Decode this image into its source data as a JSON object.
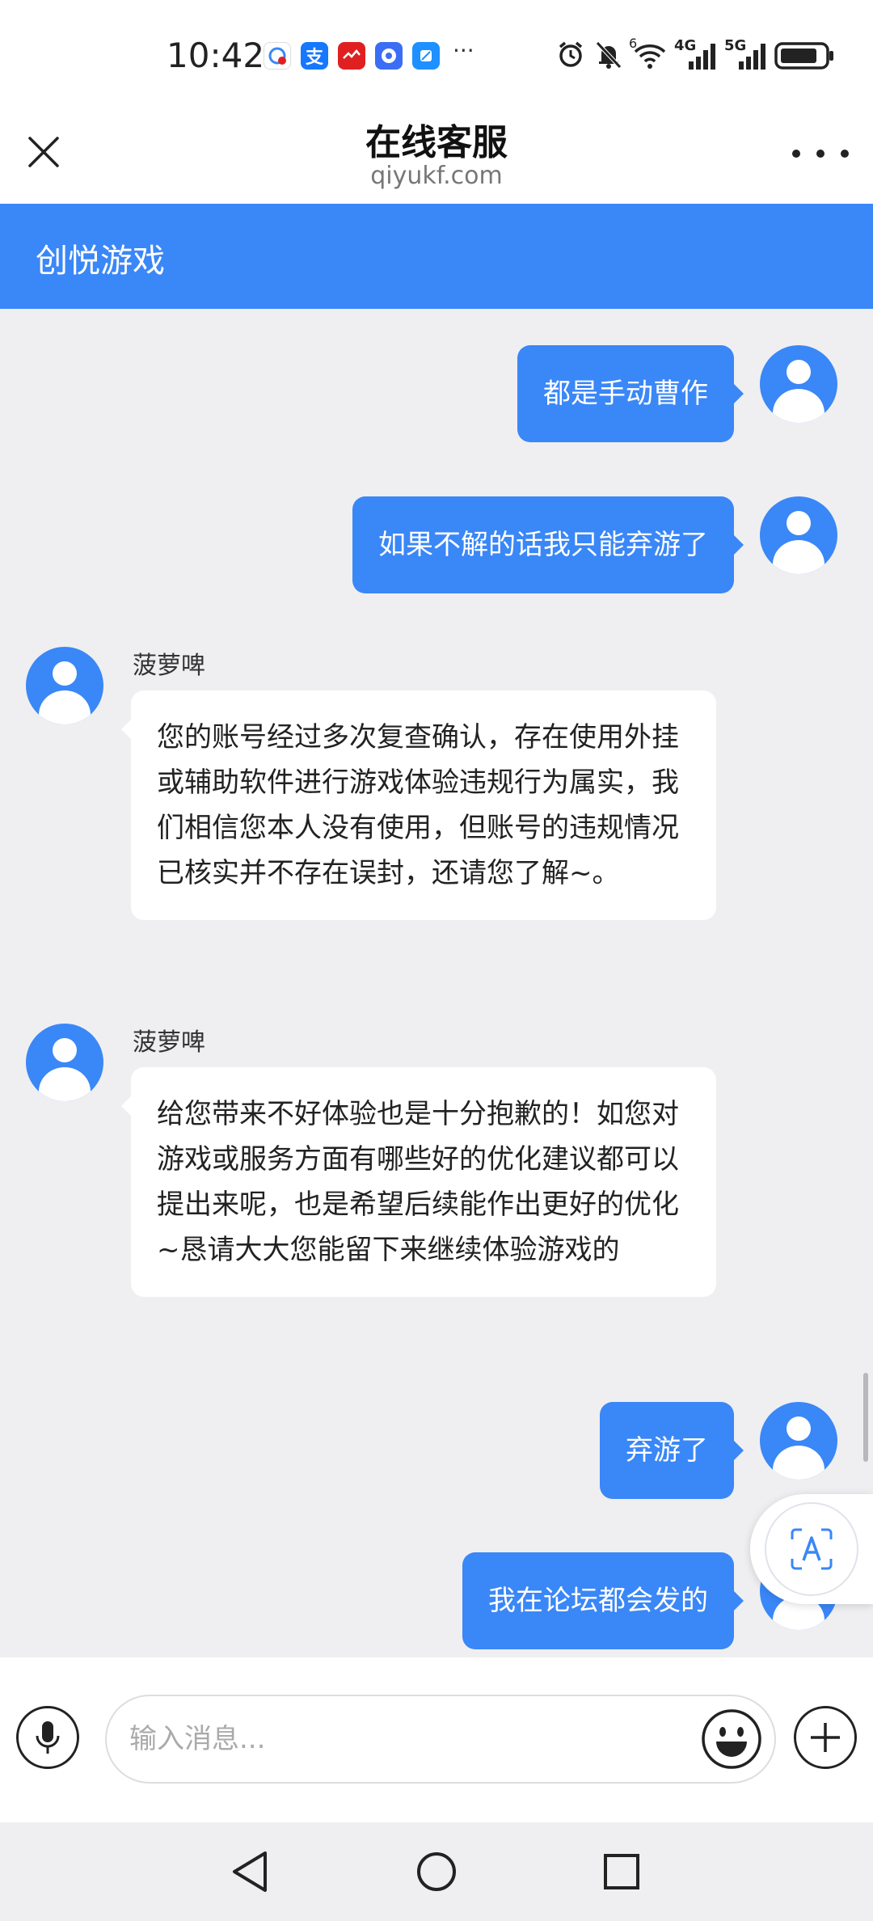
{
  "status_bar": {
    "time": "10:42",
    "notification_icons": [
      {
        "name": "app-notify-icon",
        "color": "#ffffff",
        "glyph": "◉"
      },
      {
        "name": "alipay-icon",
        "color": "#1677ff",
        "glyph": "支"
      },
      {
        "name": "red-app-icon",
        "color": "#e02020",
        "glyph": "✦"
      },
      {
        "name": "music-icon",
        "color": "#3b6ef5",
        "glyph": "♫"
      },
      {
        "name": "blue-app-icon",
        "color": "#1e90ff",
        "glyph": "◆"
      }
    ],
    "overflow": "···",
    "network_6": "6",
    "network_4g": "4G",
    "network_5g": "5G"
  },
  "titlebar": {
    "title": "在线客服",
    "domain": "qiyukf.com"
  },
  "header": {
    "name": "创悦游戏"
  },
  "messages": [
    {
      "direction": "out",
      "text": "都是手动曹作"
    },
    {
      "direction": "out",
      "text": "如果不解的话我只能弃游了"
    },
    {
      "direction": "in",
      "sender": "菠萝啤",
      "text": "您的账号经过多次复查确认，存在使用外挂或辅助软件进行游戏体验违规行为属实，我们相信您本人没有使用，但账号的违规情况已核实并不存在误封，还请您了解~。"
    },
    {
      "direction": "in",
      "sender": "菠萝啤",
      "text": "给您带来不好体验也是十分抱歉的！如您对游戏或服务方面有哪些好的优化建议都可以提出来呢，也是希望后续能作出更好的优化~恳请大大您能留下来继续体验游戏的"
    },
    {
      "direction": "out",
      "text": "弃游了"
    },
    {
      "direction": "out",
      "text": "我在论坛都会发的"
    }
  ],
  "input": {
    "placeholder": "输入消息..."
  },
  "colors": {
    "accent": "#3a87f7",
    "chat_background": "#efeff1",
    "incoming_bubble": "#ffffff"
  }
}
